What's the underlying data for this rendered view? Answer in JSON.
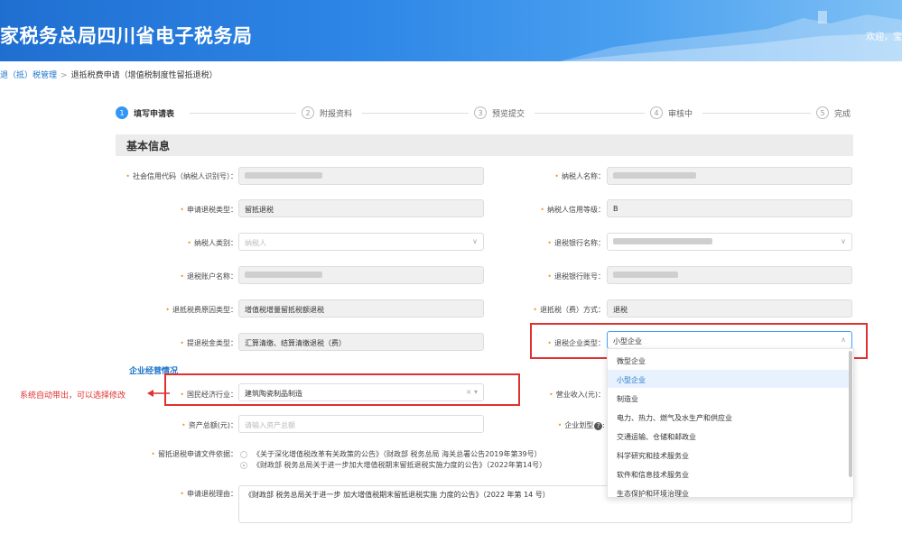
{
  "header": {
    "title": "家税务总局四川省电子税务局",
    "welcome": "欢迎，宝"
  },
  "breadcrumb": {
    "parent": "退（抵）税管理",
    "sep": ">",
    "current": "退抵税费申请（增值税制度性留抵退税）"
  },
  "steps": [
    {
      "num": "1",
      "label": "填写申请表"
    },
    {
      "num": "2",
      "label": "附报资料"
    },
    {
      "num": "3",
      "label": "预览提交"
    },
    {
      "num": "4",
      "label": "审核中"
    },
    {
      "num": "5",
      "label": "完成"
    }
  ],
  "section_title": "基本信息",
  "labels": {
    "credit_code": "社会信用代码（纳税人识别号）：",
    "taxpayer_name": "纳税人名称：",
    "refund_type": "申请退税类型：",
    "credit_level": "纳税人信用等级：",
    "taxpayer_category": "纳税人类别：",
    "bank_name": "退税银行名称：",
    "account_name": "退税账户名称：",
    "bank_account": "退税银行账号：",
    "reason_type": "退抵税费原因类型：",
    "refund_method": "退抵税（费）方式：",
    "fund_type": "提退税金类型：",
    "enterprise_type": "退税企业类型：",
    "industry": "国民经济行业：",
    "revenue": "营业收入(元)：",
    "assets": "资产总额(元)：",
    "scale": "企业划型",
    "doc_basis": "留抵退税申请文件依据：",
    "reason": "申请退税理由："
  },
  "values": {
    "refund_type": "留抵退税",
    "credit_level": "B",
    "taxpayer_category_placeholder": "纳税人",
    "reason_type": "增值税增量留抵税额退税",
    "refund_method": "退税",
    "fund_type": "汇算清缴、结算清缴退税（费）",
    "enterprise_type": "小型企业",
    "industry": "建筑陶瓷制品制造",
    "assets_placeholder": "请输入资产总额",
    "reason": "《财政部 税务总局关于进一步 加大增值税期末留抵退税实施 力度的公告》（2022 年第 14 号）"
  },
  "subsection": "企业经营情况",
  "annotation": "系统自动带出，可以选择修改",
  "doc_options": [
    {
      "text": "《关于深化增值税改革有关政策的公告》（财政部 税务总局 海关总署公告2019年第39号）",
      "checked": false
    },
    {
      "text": "《财政部 税务总局关于进一步加大增值税期末留抵退税实施力度的公告》（2022年第14号）",
      "checked": true
    }
  ],
  "dropdown_options": [
    "微型企业",
    "小型企业",
    "制造业",
    "电力、热力、燃气及水生产和供应业",
    "交通运输、仓储和邮政业",
    "科学研究和技术服务业",
    "软件和信息技术服务业",
    "生态保护和环境治理业"
  ],
  "dropdown_selected": "小型企业",
  "colors": {
    "accent": "#3296f5",
    "annotation": "#e03030",
    "required": "#f29b2e"
  }
}
